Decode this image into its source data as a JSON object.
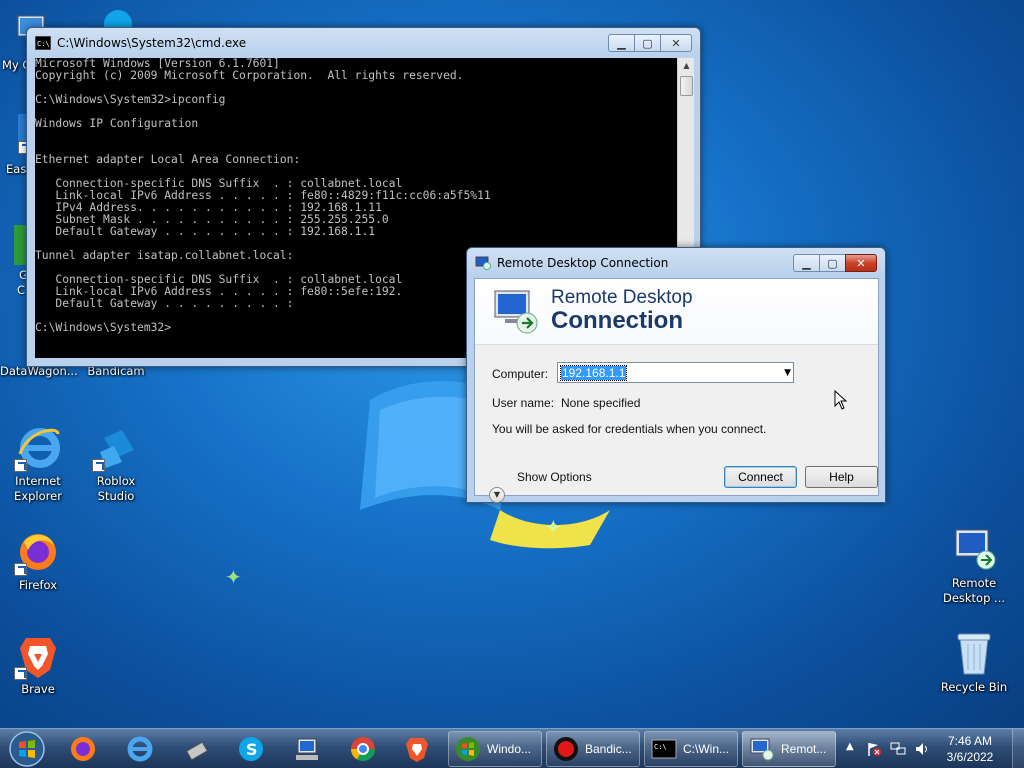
{
  "desktop": {
    "icons": [
      {
        "id": "my-computer",
        "label": "My C"
      },
      {
        "id": "easeus",
        "label": "Eas"
      },
      {
        "id": "g-partial",
        "label": "G"
      },
      {
        "id": "c-partial",
        "label": "C"
      },
      {
        "id": "datawagon",
        "label": "DataWagon..."
      },
      {
        "id": "bandicam",
        "label": "Bandicam"
      },
      {
        "id": "ie",
        "label": "Internet Explorer"
      },
      {
        "id": "roblox",
        "label": "Roblox Studio"
      },
      {
        "id": "firefox",
        "label": "Firefox"
      },
      {
        "id": "brave",
        "label": "Brave"
      },
      {
        "id": "rdc",
        "label": "Remote Desktop ..."
      },
      {
        "id": "recycle",
        "label": "Recycle Bin"
      }
    ]
  },
  "cmd": {
    "title": "C:\\Windows\\System32\\cmd.exe",
    "output": "Microsoft Windows [Version 6.1.7601]\nCopyright (c) 2009 Microsoft Corporation.  All rights reserved.\n\nC:\\Windows\\System32>ipconfig\n\nWindows IP Configuration\n\n\nEthernet adapter Local Area Connection:\n\n   Connection-specific DNS Suffix  . : collabnet.local\n   Link-local IPv6 Address . . . . . : fe80::4829:f11c:cc06:a5f5%11\n   IPv4 Address. . . . . . . . . . . : 192.168.1.11\n   Subnet Mask . . . . . . . . . . . : 255.255.255.0\n   Default Gateway . . . . . . . . . : 192.168.1.1\n\nTunnel adapter isatap.collabnet.local:\n\n   Connection-specific DNS Suffix  . : collabnet.local\n   Link-local IPv6 Address . . . . . : fe80::5efe:192.\n   Default Gateway . . . . . . . . . :\n\nC:\\Windows\\System32>"
  },
  "rdc": {
    "title": "Remote Desktop Connection",
    "banner_line1": "Remote Desktop",
    "banner_line2": "Connection",
    "computer_label": "Computer:",
    "computer_value": "192.168.1.1",
    "username_label": "User name:",
    "username_value": "None specified",
    "info_text": "You will be asked for credentials when you connect.",
    "show_options": "Show Options",
    "connect": "Connect",
    "help": "Help"
  },
  "taskbar": {
    "pinned": [
      "firefox",
      "internet-explorer",
      "usb-tool",
      "skype",
      "network-tool",
      "chrome",
      "brave"
    ],
    "buttons": [
      {
        "label": "Windo...",
        "icon": "windows-media-icon"
      },
      {
        "label": "Bandic...",
        "icon": "bandicam-record-icon"
      },
      {
        "label": "C:\\Win...",
        "icon": "cmd-icon"
      },
      {
        "label": "Remot...",
        "icon": "remote-desktop-icon"
      }
    ],
    "clock_time": "7:46 AM",
    "clock_date": "3/6/2022"
  },
  "colors": {
    "desktop_blue": "#1672c8",
    "selection": "#3399ff",
    "banner_text": "#1b3a6b",
    "close_red": "#c9432c"
  }
}
